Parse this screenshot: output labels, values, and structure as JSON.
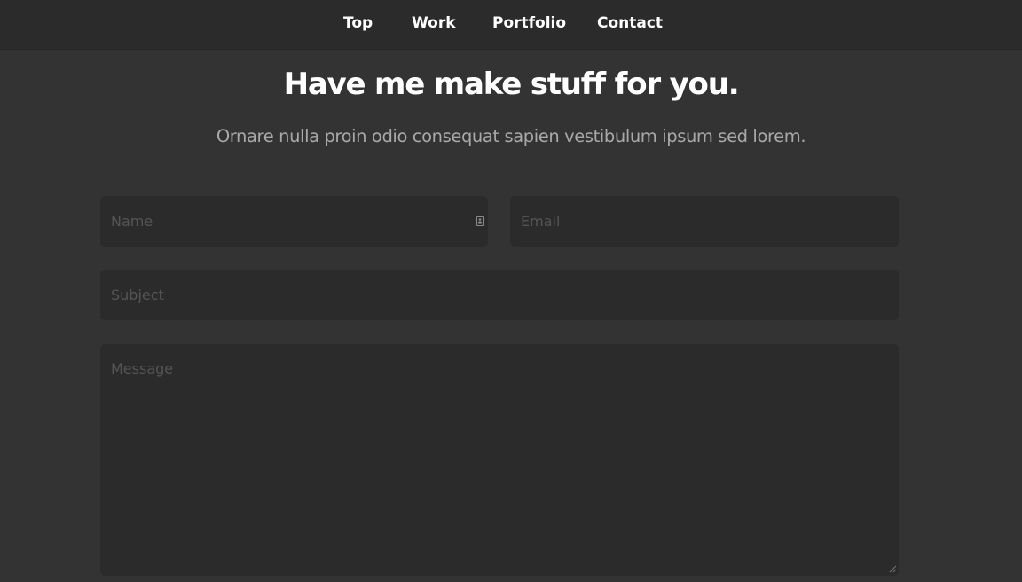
{
  "nav": {
    "items": [
      {
        "label": "Top"
      },
      {
        "label": "Work"
      },
      {
        "label": "Portfolio"
      },
      {
        "label": "Contact"
      }
    ]
  },
  "hero": {
    "title": "Have me make stuff for you.",
    "subtitle": "Ornare nulla proin odio consequat sapien vestibulum ipsum sed lorem."
  },
  "form": {
    "name": {
      "placeholder": "Name",
      "value": ""
    },
    "email": {
      "placeholder": "Email",
      "value": ""
    },
    "subject": {
      "placeholder": "Subject",
      "value": ""
    },
    "message": {
      "placeholder": "Message",
      "value": ""
    }
  },
  "icons": {
    "name_field_icon": "contact-card-icon",
    "textarea_resize": "resize-grip-icon"
  },
  "colors": {
    "background": "#333333",
    "nav_background": "#2b2b2b",
    "field_background": "#2b2b2b",
    "heading": "#ffffff",
    "subtitle": "#a9a9a9",
    "placeholder": "#555555"
  }
}
